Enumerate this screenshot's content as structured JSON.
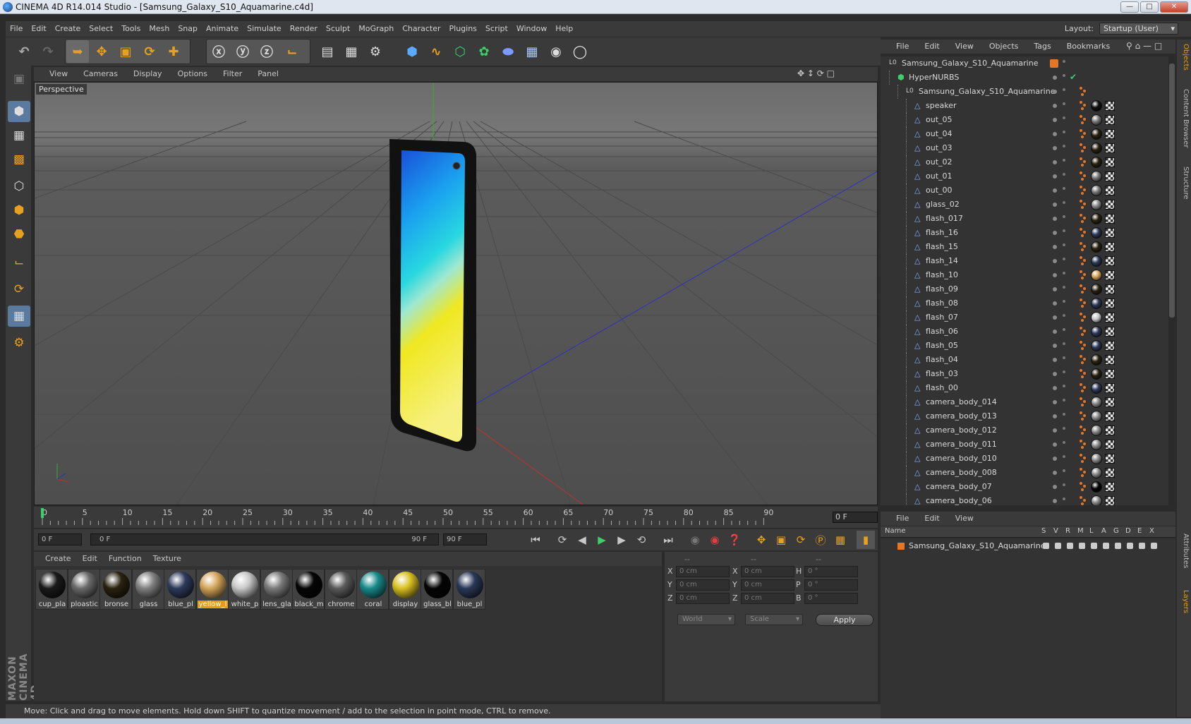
{
  "window": {
    "title": "CINEMA 4D R14.014 Studio - [Samsung_Galaxy_S10_Aquamarine.c4d]"
  },
  "menu": [
    "File",
    "Edit",
    "Create",
    "Select",
    "Tools",
    "Mesh",
    "Snap",
    "Animate",
    "Simulate",
    "Render",
    "Sculpt",
    "MoGraph",
    "Character",
    "Plugins",
    "Script",
    "Window",
    "Help"
  ],
  "layout": {
    "label": "Layout:",
    "value": "Startup (User)"
  },
  "viewport": {
    "menu": [
      "View",
      "Cameras",
      "Display",
      "Options",
      "Filter",
      "Panel"
    ],
    "label": "Perspective"
  },
  "timeline": {
    "ticks": [
      "0",
      "5",
      "10",
      "15",
      "20",
      "25",
      "30",
      "35",
      "40",
      "45",
      "50",
      "55",
      "60",
      "65",
      "70",
      "75",
      "80",
      "85",
      "90"
    ],
    "current_frame": "0 F"
  },
  "transport": {
    "start": "0 F",
    "range_start": "0 F",
    "range_end": "90 F",
    "end": "90 F"
  },
  "materials": {
    "menu": [
      "Create",
      "Edit",
      "Function",
      "Texture"
    ],
    "items": [
      {
        "name": "cup_pla",
        "color": "#1a1a1a"
      },
      {
        "name": "ploastic",
        "color": "#6a6a6a"
      },
      {
        "name": "bronse",
        "color": "#2a2210"
      },
      {
        "name": "glass",
        "color": "#808080"
      },
      {
        "name": "blue_pl",
        "color": "#2d3a5a"
      },
      {
        "name": "yellow_l",
        "color": "#d4a55a",
        "selected": true
      },
      {
        "name": "white_p",
        "color": "#c8c8c8"
      },
      {
        "name": "lens_gla",
        "color": "#7a7a7a"
      },
      {
        "name": "black_m",
        "color": "#060606"
      },
      {
        "name": "chrome",
        "color": "#5a5a5a"
      },
      {
        "name": "coral",
        "color": "#188a8a"
      },
      {
        "name": "display",
        "color": "#d8c020"
      },
      {
        "name": "glass_bl",
        "color": "#050505"
      },
      {
        "name": "blue_pl",
        "color": "#2a3858"
      }
    ]
  },
  "coords": {
    "header": [
      "--",
      "--",
      "--"
    ],
    "rows": [
      {
        "a": "X",
        "av": "0 cm",
        "b": "X",
        "bv": "0 cm",
        "c": "H",
        "cv": "0 °"
      },
      {
        "a": "Y",
        "av": "0 cm",
        "b": "Y",
        "bv": "0 cm",
        "c": "P",
        "cv": "0 °"
      },
      {
        "a": "Z",
        "av": "0 cm",
        "b": "Z",
        "bv": "0 cm",
        "c": "B",
        "cv": "0 °"
      }
    ],
    "space": "World",
    "mode": "Scale",
    "apply": "Apply"
  },
  "status": "Move: Click and drag to move elements. Hold down SHIFT to quantize movement / add to the selection in point mode, CTRL to remove.",
  "objects": {
    "menu": [
      "File",
      "Edit",
      "View",
      "Objects",
      "Tags",
      "Bookmarks"
    ],
    "tree": [
      {
        "name": "Samsung_Galaxy_S10_Aquamarine",
        "depth": 0,
        "kind": "null"
      },
      {
        "name": "HyperNURBS",
        "depth": 1,
        "kind": "nurbs"
      },
      {
        "name": "Samsung_Galaxy_S10_Aquamarine",
        "depth": 2,
        "kind": "null"
      },
      {
        "name": "speaker",
        "depth": 3,
        "mat": "#111"
      },
      {
        "name": "out_05",
        "depth": 3,
        "mat": "#777"
      },
      {
        "name": "out_04",
        "depth": 3,
        "mat": "#2a2210"
      },
      {
        "name": "out_03",
        "depth": 3,
        "mat": "#2a2210"
      },
      {
        "name": "out_02",
        "depth": 3,
        "mat": "#2a2210"
      },
      {
        "name": "out_01",
        "depth": 3,
        "mat": "#777"
      },
      {
        "name": "out_00",
        "depth": 3,
        "mat": "#777"
      },
      {
        "name": "glass_02",
        "depth": 3,
        "mat": "#888"
      },
      {
        "name": "flash_017",
        "depth": 3,
        "mat": "#2a2210"
      },
      {
        "name": "flash_16",
        "depth": 3,
        "mat": "#2d3a5a"
      },
      {
        "name": "flash_15",
        "depth": 3,
        "mat": "#2a2210"
      },
      {
        "name": "flash_14",
        "depth": 3,
        "mat": "#2d3a5a"
      },
      {
        "name": "flash_10",
        "depth": 3,
        "mat": "#d4a55a"
      },
      {
        "name": "flash_09",
        "depth": 3,
        "mat": "#2a2210"
      },
      {
        "name": "flash_08",
        "depth": 3,
        "mat": "#2d3a5a"
      },
      {
        "name": "flash_07",
        "depth": 3,
        "mat": "#c8c8c8"
      },
      {
        "name": "flash_06",
        "depth": 3,
        "mat": "#2d3a5a"
      },
      {
        "name": "flash_05",
        "depth": 3,
        "mat": "#2d3a5a"
      },
      {
        "name": "flash_04",
        "depth": 3,
        "mat": "#2a2210"
      },
      {
        "name": "flash_03",
        "depth": 3,
        "mat": "#2a2210"
      },
      {
        "name": "flash_00",
        "depth": 3,
        "mat": "#2d3a5a"
      },
      {
        "name": "camera_body_014",
        "depth": 3,
        "mat": "#888"
      },
      {
        "name": "camera_body_013",
        "depth": 3,
        "mat": "#888"
      },
      {
        "name": "camera_body_012",
        "depth": 3,
        "mat": "#888"
      },
      {
        "name": "camera_body_011",
        "depth": 3,
        "mat": "#888"
      },
      {
        "name": "camera_body_010",
        "depth": 3,
        "mat": "#888"
      },
      {
        "name": "camera_body_008",
        "depth": 3,
        "mat": "#888"
      },
      {
        "name": "camera_body_07",
        "depth": 3,
        "mat": "#050505"
      },
      {
        "name": "camera_body_06",
        "depth": 3,
        "mat": "#888"
      }
    ]
  },
  "layers": {
    "menu": [
      "File",
      "Edit",
      "View"
    ],
    "columns": [
      "Name",
      "S",
      "V",
      "R",
      "M",
      "L",
      "A",
      "G",
      "D",
      "E",
      "X"
    ],
    "rows": [
      {
        "name": "Samsung_Galaxy_S10_Aquamarine",
        "color": "#e2772a"
      }
    ]
  },
  "side_tabs": [
    "Objects",
    "Content Browser",
    "Structure",
    "Attributes",
    "Layers"
  ],
  "colors": {
    "accent": "#e89a10",
    "bg": "#3a3a3a",
    "viewport_bg": "#5a5a5a",
    "axis_x": "#c03030",
    "axis_y": "#30b030",
    "axis_z": "#3030c0"
  }
}
